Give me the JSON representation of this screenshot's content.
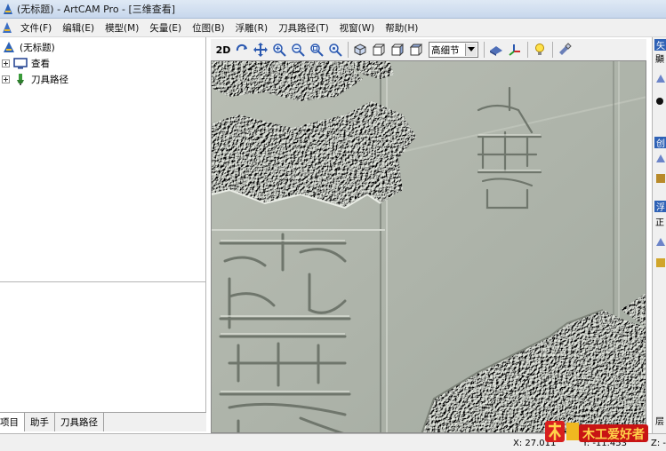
{
  "window": {
    "title": "(无标题) - ArtCAM Pro - [三维查看]"
  },
  "menu": {
    "items": [
      "文件(F)",
      "编辑(E)",
      "模型(M)",
      "矢量(E)",
      "位图(B)",
      "浮雕(R)",
      "刀具路径(T)",
      "视窗(W)",
      "帮助(H)"
    ]
  },
  "tree": {
    "root": "(无标题)",
    "items": [
      "查看",
      "刀具路径"
    ]
  },
  "tabs": {
    "items": [
      "项目",
      "助手",
      "刀具路径"
    ]
  },
  "toolbar": {
    "twod_label": "2D",
    "detail_value": "高细节",
    "icons": [
      "rotate-icon",
      "pan-icon",
      "zoom-in-icon",
      "zoom-out-icon",
      "zoom-box-icon",
      "zoom-fit-icon",
      "iso-view-icon",
      "front-view-icon",
      "side-view-icon",
      "top-view-icon",
      "shading-icon",
      "axis-icon",
      "light-icon",
      "settings-icon"
    ]
  },
  "right_panel": {
    "heads": [
      "矢",
      "创",
      "浮"
    ],
    "texts": [
      "顯",
      "正",
      "层"
    ]
  },
  "status": {
    "x": "X: 27.011",
    "y": "Y: -11.453",
    "z": "Z: -"
  },
  "logo": {
    "text": "木工爱好者"
  },
  "colors": {
    "titlebar": "#c7d7ec",
    "menubar": "#f0f0f0",
    "viewport_bg": "#a9b0a6",
    "panel_head": "#2f62b6"
  }
}
